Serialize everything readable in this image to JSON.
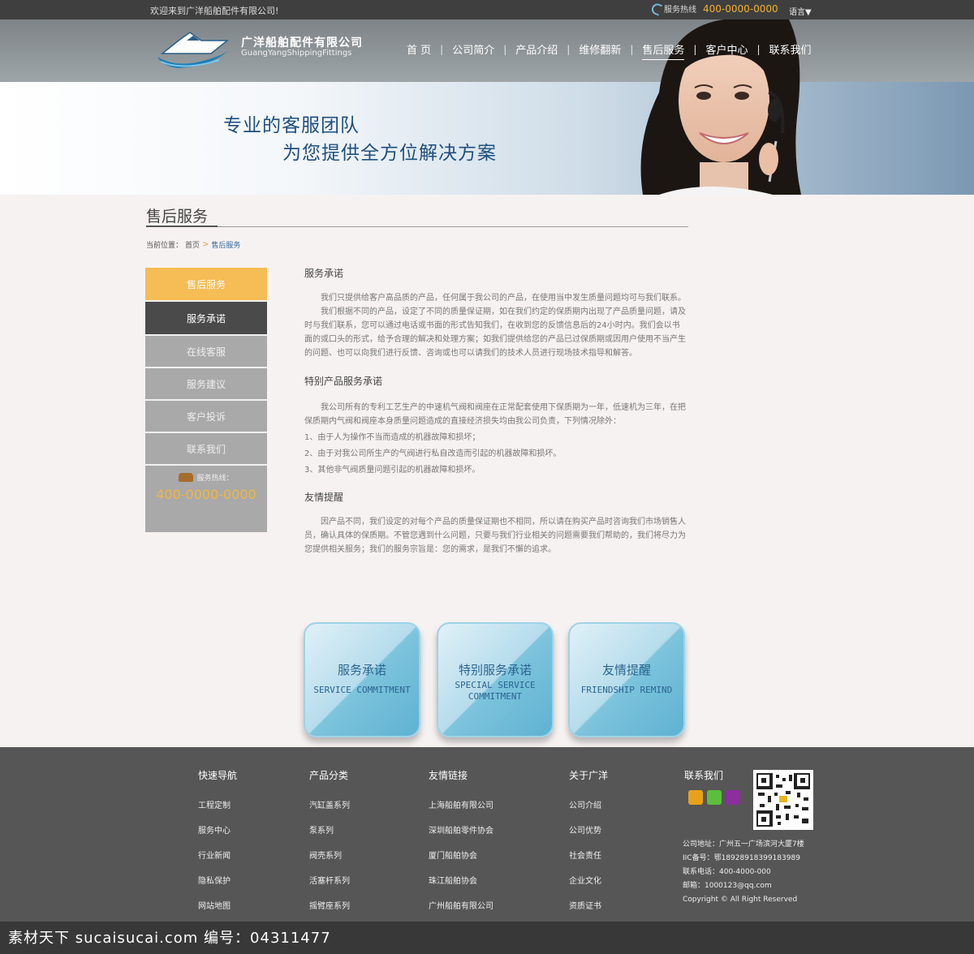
{
  "topbar": {
    "welcome": "欢迎来到广洋船舶配件有限公司!",
    "hotline_label": "服务热线",
    "hotline_number": "400-0000-0000",
    "language": "语言▼"
  },
  "brand": {
    "name_cn": "广洋船舶配件有限公司",
    "name_en": "GuangYangShippingFittings"
  },
  "nav": [
    {
      "label": "首 页"
    },
    {
      "label": "公司简介"
    },
    {
      "label": "产品介绍"
    },
    {
      "label": "维修翻新"
    },
    {
      "label": "售后服务",
      "active": true
    },
    {
      "label": "客户中心"
    },
    {
      "label": "联系我们"
    }
  ],
  "banner": {
    "slogan1": "专业的客服团队",
    "slogan2": "为您提供全方位解决方案"
  },
  "page": {
    "title": "售后服务",
    "breadcrumb_prefix": "当前位置：",
    "breadcrumb_home": "首页",
    "breadcrumb_arrow": ">",
    "breadcrumb_current": "售后服务"
  },
  "sidebar": {
    "header": "售后服务",
    "items": [
      "服务承诺",
      "在线客服",
      "服务建议",
      "客户投诉",
      "联系我们"
    ],
    "hotline_label": "服务热线：",
    "hotline_number": "400-0000-0000"
  },
  "content": {
    "sec1_title": "服务承诺",
    "sec1_p1": "我们只提供给客户高品质的产品，任何属于我公司的产品，在使用当中发生质量问题均可与我们联系。",
    "sec1_p2": "我们根据不同的产品，设定了不同的质量保证期，如在我们约定的保质期内出现了产品质量问题，请及时与我们联系，您可以通过电话或书面的形式告知我们，在收到您的反馈信息后的24小时内。我们会以书面的或口头的形式，给予合理的解决和处理方案；如我们提供给您的产品已过保质期或因用户使用不当产生的问题、也可以向我们进行反馈、咨询或也可以请我们的技术人员进行现场技术指导和解答。",
    "sec2_title": "特别产品服务承诺",
    "sec2_p1": "我公司所有的专利工艺生产的中速机气阀和阀座在正常配套使用下保质期为一年，低速机为三年，在把保质期内气阀和阀座本身质量问题造成的直接经济损失均由我公司负责，下列情况除外：",
    "sec2_items": [
      "1、由于人为操作不当而造成的机器故障和损坏；",
      "2、由于对我公司所生产的气阀进行私自改造而引起的机器故障和损坏。",
      "3、其他非气阀质量问题引起的机器故障和损坏。"
    ],
    "sec3_title": "友情提醒",
    "sec3_p1": "因产品不同，我们设定的对每个产品的质量保证期也不相同，所以请在购买产品时咨询我们市场销售人员，确认具体的保质期。不管您遇到什么问题，只要与我们行业相关的问题需要我们帮助的，我们将尽力为您提供相关服务；我们的服务宗旨是：您的需求，是我们不懈的追求。"
  },
  "cards": [
    {
      "cn": "服务承诺",
      "en": "SERVICE COMMITMENT"
    },
    {
      "cn": "特别服务承诺",
      "en": "SPECIAL SERVICE COMMITMENT"
    },
    {
      "cn": "友情提醒",
      "en": "FRIENDSHIP REMIND"
    }
  ],
  "footer": {
    "cols": [
      {
        "head": "快速导航",
        "links": [
          "工程定制",
          "服务中心",
          "行业新闻",
          "隐私保护",
          "网站地图"
        ]
      },
      {
        "head": "产品分类",
        "links": [
          "汽缸盖系列",
          "泵系列",
          "阀壳系列",
          "活塞杆系列",
          "摇臂座系列"
        ]
      },
      {
        "head": "友情链接",
        "links": [
          "上海船舶有限公司",
          "深圳船舶零件协会",
          "厦门船舶协会",
          "珠江船舶协会",
          "广州船舶有限公司"
        ]
      },
      {
        "head": "关于广洋",
        "links": [
          "公司介绍",
          "公司优势",
          "社会责任",
          "企业文化",
          "资质证书"
        ]
      }
    ],
    "contact_title": "联系我们",
    "address": "公司地址：广州五一广场滨河大厦7楼",
    "icp": "IIC备号：鄂18928918399183989",
    "phone": "联系电话：400-4000-000",
    "email": "邮箱：1000123@qq.com",
    "copyright": "Copyright ©  All Right Reserved",
    "social_colors": [
      "#e8a21a",
      "#5bbf3c",
      "#8a2f9c"
    ]
  },
  "watermark": "素材天下 sucaisucai.com   编号：04311477"
}
